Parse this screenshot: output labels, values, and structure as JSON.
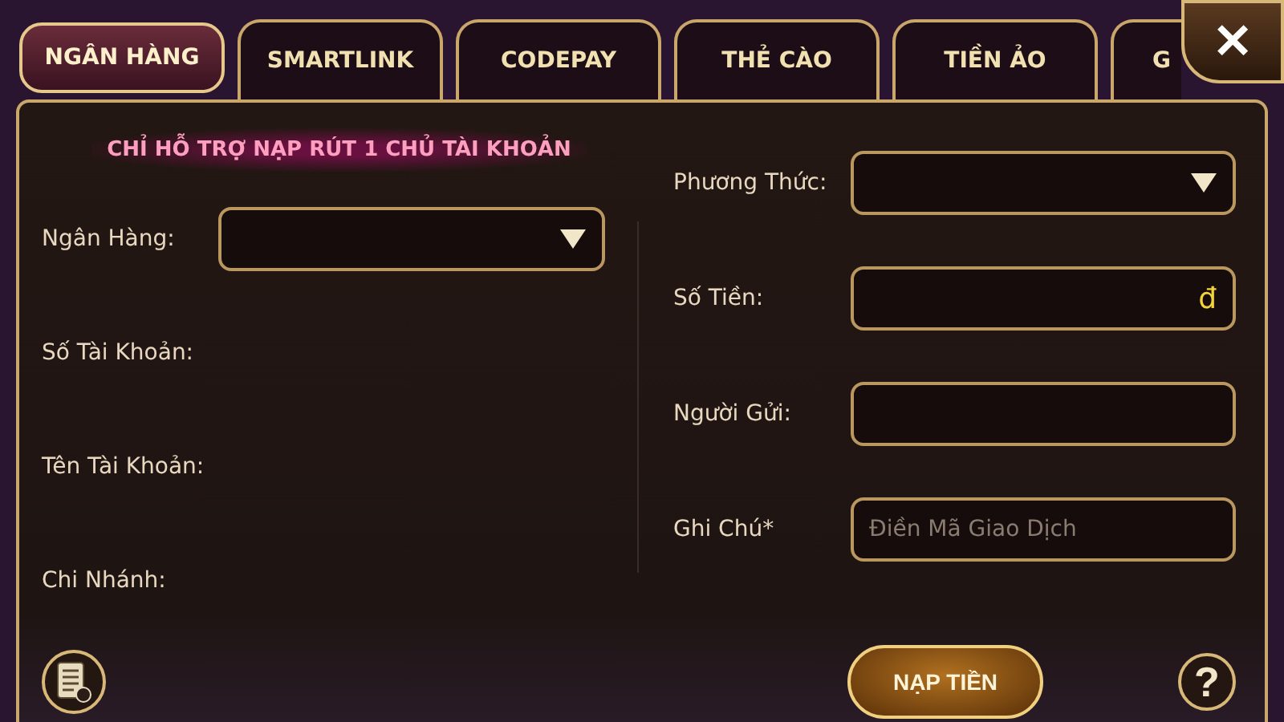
{
  "tabs": [
    {
      "label": "NGÂN HÀNG",
      "selected": true
    },
    {
      "label": "SMARTLINK",
      "selected": false
    },
    {
      "label": "CODEPAY",
      "selected": false
    },
    {
      "label": "THẺ CÀO",
      "selected": false
    },
    {
      "label": "TIỀN ẢO",
      "selected": false
    },
    {
      "label": "G",
      "selected": false
    }
  ],
  "close_button": "✕",
  "notice": "CHỈ HỖ TRỢ NẠP RÚT 1 CHỦ TÀI KHOẢN",
  "left_fields": [
    {
      "label": "Ngân Hàng:",
      "kind": "select"
    },
    {
      "label": "Số Tài Khoản:",
      "kind": "info"
    },
    {
      "label": "Tên Tài Khoản:",
      "kind": "info"
    },
    {
      "label": "Chi Nhánh:",
      "kind": "info"
    }
  ],
  "right_fields": [
    {
      "label": "Phương Thức:",
      "kind": "select"
    },
    {
      "label": "Số Tiền:",
      "kind": "input",
      "suffix": "đ"
    },
    {
      "label": "Người Gửi:",
      "kind": "input"
    },
    {
      "label": "Ghi Chú*",
      "kind": "input",
      "placeholder": "Điền Mã Giao Dịch"
    }
  ],
  "submit_button": "NẠP TIỀN",
  "help_button": "?"
}
